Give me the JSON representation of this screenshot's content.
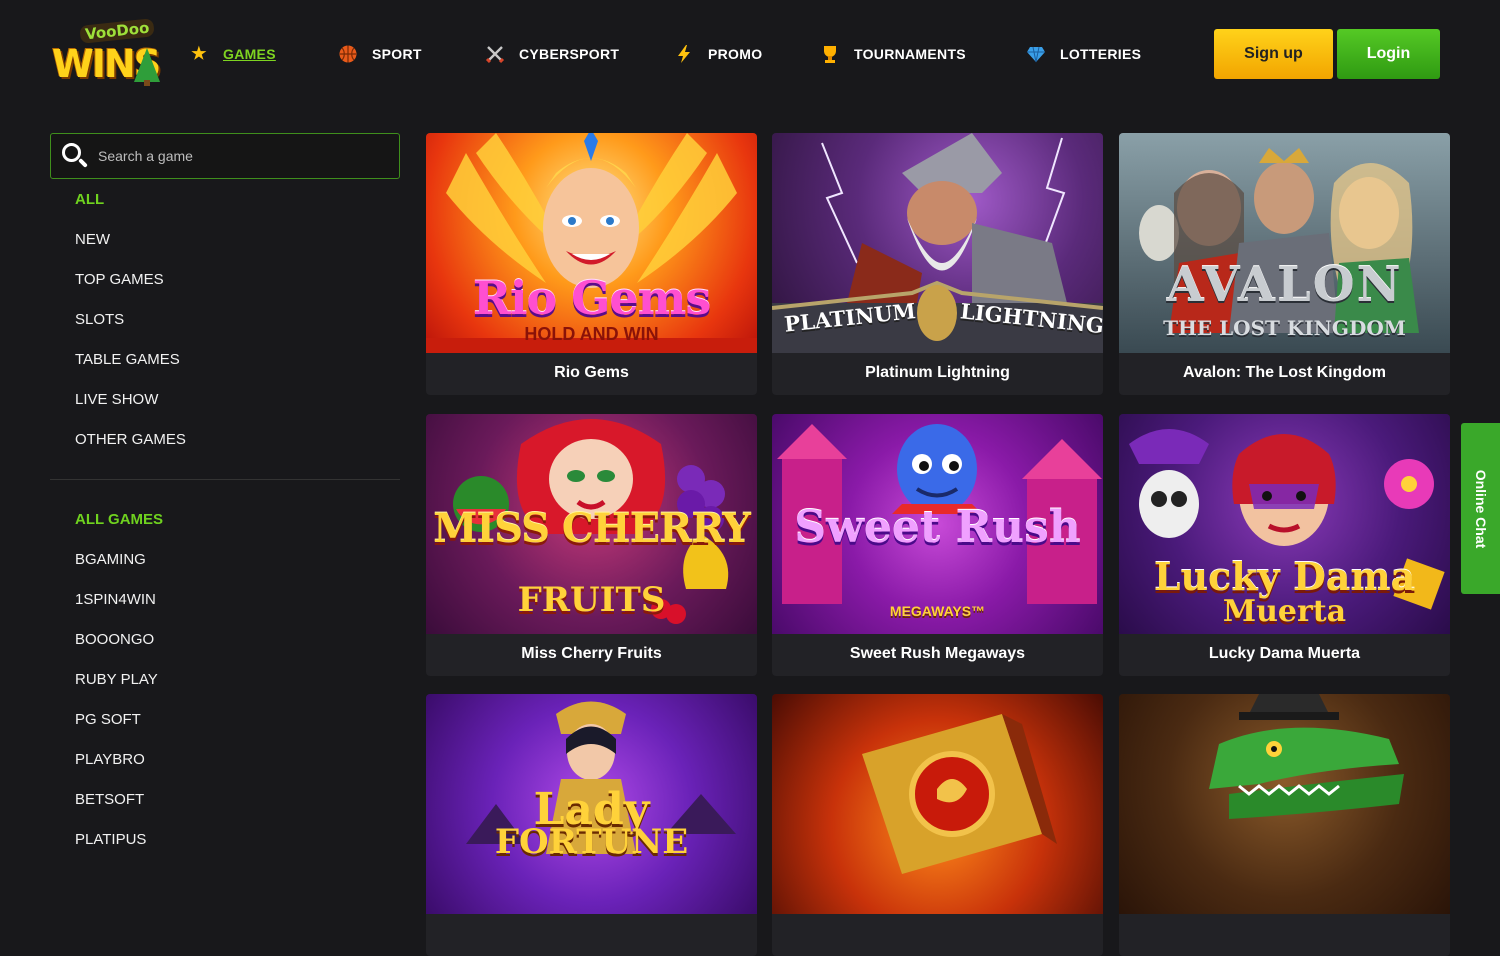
{
  "brand": {
    "logo_top": "VooDoo",
    "logo_main": "WINS"
  },
  "nav": [
    {
      "label": "GAMES",
      "icon": "star-icon"
    },
    {
      "label": "SPORT",
      "icon": "basketball-icon"
    },
    {
      "label": "CYBERSPORT",
      "icon": "crossed-swords-icon"
    },
    {
      "label": "PROMO",
      "icon": "lightning-icon"
    },
    {
      "label": "TOURNAMENTS",
      "icon": "trophy-icon"
    },
    {
      "label": "LOTTERIES",
      "icon": "diamond-icon"
    }
  ],
  "auth": {
    "signup_label": "Sign up",
    "login_label": "Login"
  },
  "search": {
    "placeholder": "Search a game"
  },
  "categories": [
    "ALL",
    "NEW",
    "TOP GAMES",
    "SLOTS",
    "TABLE GAMES",
    "LIVE SHOW",
    "OTHER GAMES"
  ],
  "providers": [
    "ALL GAMES",
    "BGAMING",
    "1SPIN4WIN",
    "BOOONGO",
    "RUBY PLAY",
    "PG SOFT",
    "PLAYBRO",
    "BETSOFT",
    "PLATIPUS"
  ],
  "games": [
    {
      "title": "Rio Gems",
      "art_logo": "Rio Gems",
      "art_sub": "HOLD AND WIN"
    },
    {
      "title": "Platinum Lightning",
      "art_logo": "PLATINUM",
      "art_sub": "LIGHTNING"
    },
    {
      "title": "Avalon: The Lost Kingdom",
      "art_logo": "AVALON",
      "art_sub": "THE LOST KINGDOM"
    },
    {
      "title": "Miss Cherry Fruits",
      "art_logo": "MISS CHERRY",
      "art_sub": "FRUITS"
    },
    {
      "title": "Sweet Rush Megaways",
      "art_logo": "Sweet Rush",
      "art_sub": "MEGAWAYS™"
    },
    {
      "title": "Lucky Dama Muerta",
      "art_logo": "Lucky Dama",
      "art_sub": "Muerta"
    },
    {
      "title": "",
      "art_logo": "Lady",
      "art_sub": "FORTUNE"
    },
    {
      "title": "",
      "art_logo": "",
      "art_sub": ""
    },
    {
      "title": "",
      "art_logo": "",
      "art_sub": ""
    }
  ],
  "online_chat": {
    "label": "Online Chat"
  },
  "colors": {
    "accent_green": "#6fd21f",
    "signup_yellow": "#ffc20e",
    "login_green": "#3aa82a",
    "background": "#18181b"
  }
}
